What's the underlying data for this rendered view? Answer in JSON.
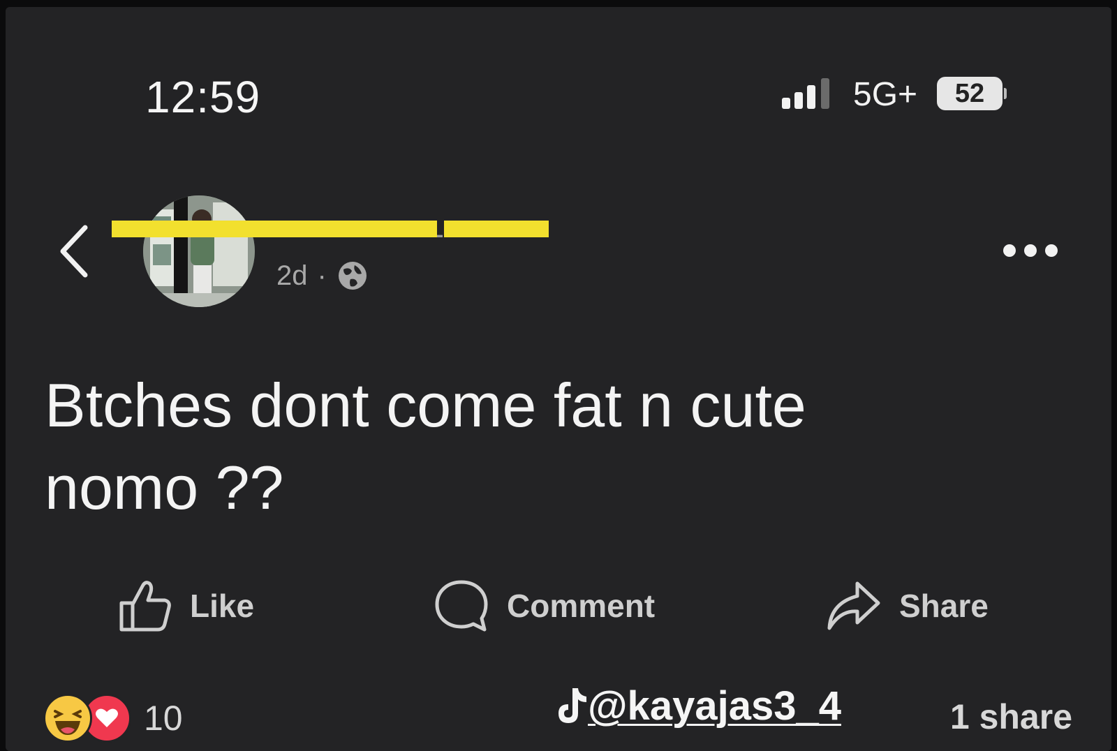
{
  "status_bar": {
    "time": "12:59",
    "network": "5G+",
    "battery": "52"
  },
  "post": {
    "posted_ago": "2d",
    "separator": "·",
    "privacy_icon": "globe-icon",
    "text_line1": "Btches dont come fat n cute",
    "text_line2": "nomo ??"
  },
  "actions": {
    "like_label": "Like",
    "comment_label": "Comment",
    "share_label": "Share"
  },
  "footer": {
    "reaction_count": "10",
    "share_count": "1 share",
    "watermark_user": "@kayajas3_4"
  },
  "colors": {
    "background": "#232325",
    "redaction": "#f2e02e",
    "haha": "#f7c844",
    "love": "#f0384f"
  }
}
